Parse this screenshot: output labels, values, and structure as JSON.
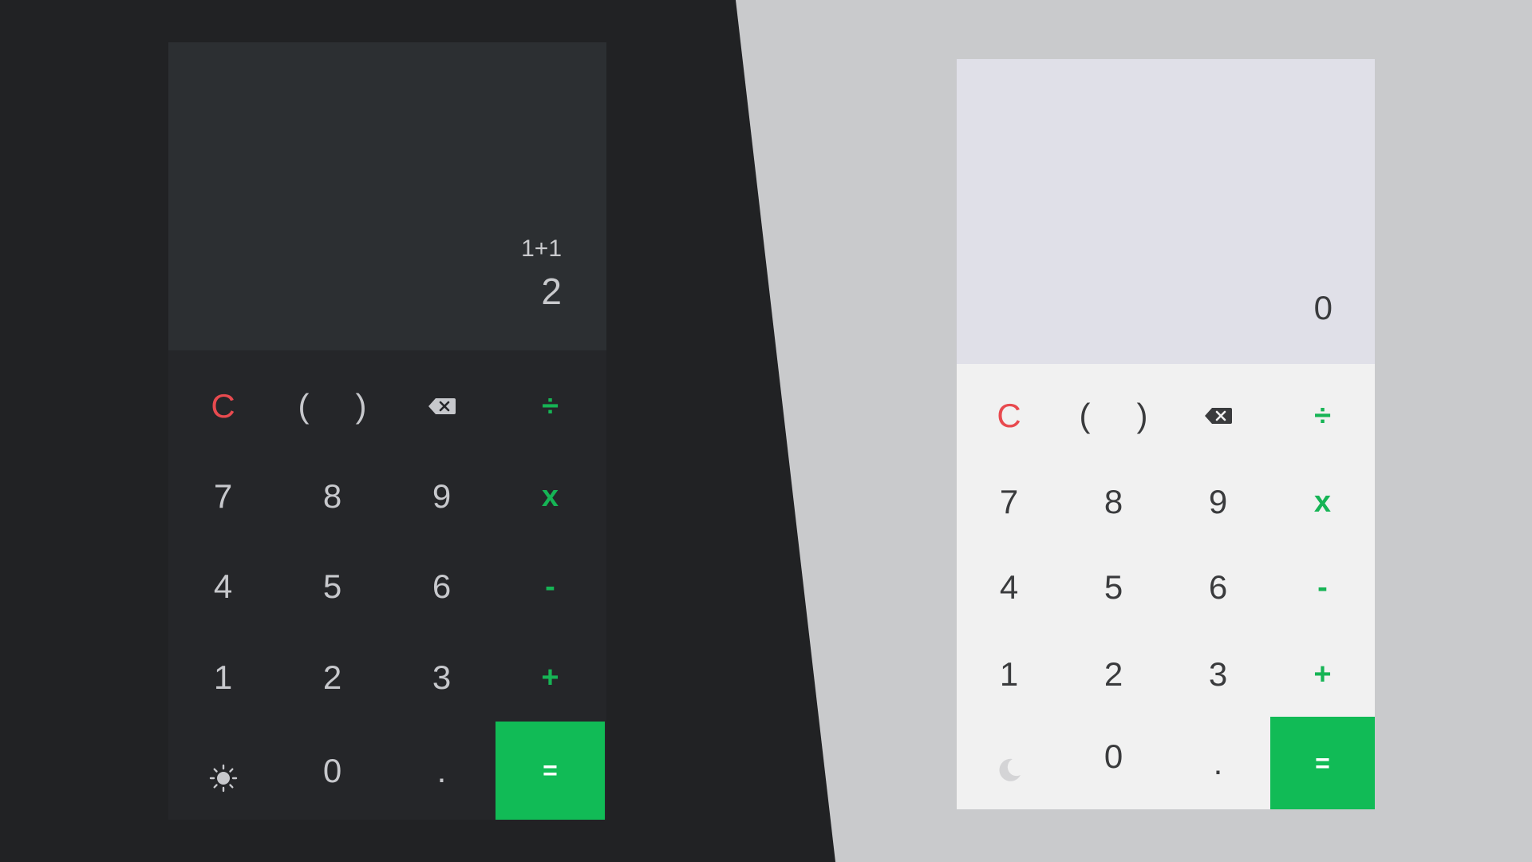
{
  "colors": {
    "dark_background": "#212224",
    "light_background": "#c9cacc",
    "accent_green": "#11bb56",
    "clear_red": "#e84a4f"
  },
  "dark_calculator": {
    "display": {
      "expression": "1+1",
      "result": "2"
    },
    "keys": {
      "clear": "C",
      "paren_open": "(",
      "paren_close": ")",
      "backspace": "backspace-icon",
      "divide": "÷",
      "k7": "7",
      "k8": "8",
      "k9": "9",
      "multiply": "x",
      "k4": "4",
      "k5": "5",
      "k6": "6",
      "minus": "-",
      "k1": "1",
      "k2": "2",
      "k3": "3",
      "plus": "+",
      "theme_toggle": "sun-icon",
      "k0": "0",
      "decimal": ".",
      "equals": "="
    }
  },
  "light_calculator": {
    "display": {
      "expression": "",
      "result": "0"
    },
    "keys": {
      "clear": "C",
      "paren_open": "(",
      "paren_close": ")",
      "backspace": "backspace-icon",
      "divide": "÷",
      "k7": "7",
      "k8": "8",
      "k9": "9",
      "multiply": "x",
      "k4": "4",
      "k5": "5",
      "k6": "6",
      "minus": "-",
      "k1": "1",
      "k2": "2",
      "k3": "3",
      "plus": "+",
      "theme_toggle": "moon-icon",
      "k0": "0",
      "decimal": ".",
      "equals": "="
    }
  }
}
